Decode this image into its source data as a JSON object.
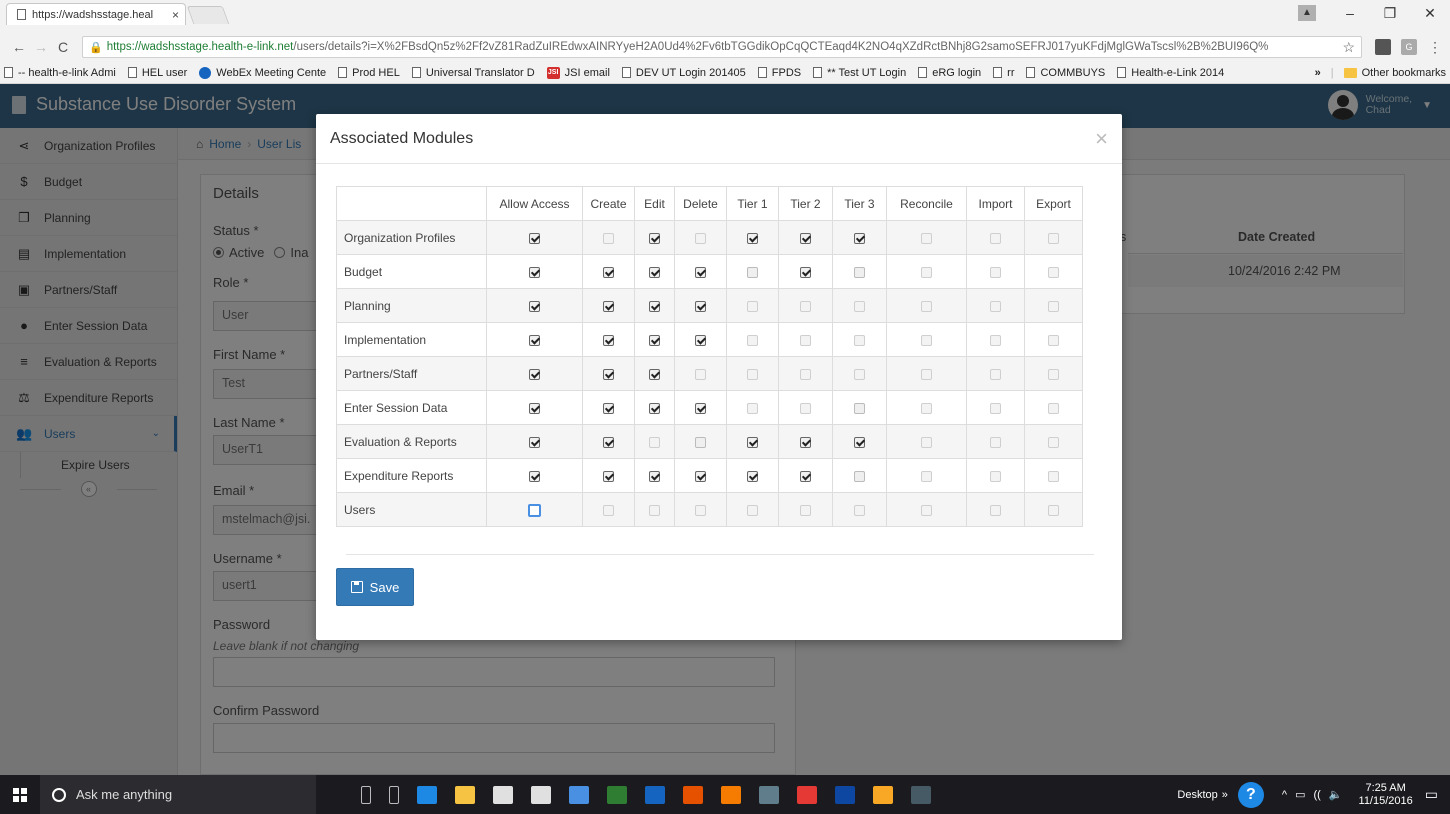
{
  "browser": {
    "tab_title": "https://wadshsstage.heal",
    "tab_close": "×",
    "window_controls": [
      "–",
      "❐",
      "✕"
    ],
    "url_host": "https://wadshsstage.health-e-link.net",
    "url_path": "/users/details?i=X%2FBsdQn5z%2Ff2vZ81RadZuIREdwxAINRYyeH2A0Ud4%2Fv6tbTGGdikOpCqQCTEaqd4K2NO4qXZdRctBNhj8G2samoSEFRJ017yuKFdjMglGWaTscsl%2B%2BUI96Q%",
    "bookmarks": [
      {
        "label": "-- health-e-link Admi",
        "icon": "page-icon"
      },
      {
        "label": "HEL user",
        "icon": "page-icon"
      },
      {
        "label": "WebEx Meeting Cente",
        "icon": "globe-icon"
      },
      {
        "label": "Prod HEL",
        "icon": "page-icon"
      },
      {
        "label": "Universal Translator D",
        "icon": "page-icon"
      },
      {
        "label": "JSI email",
        "icon": "jsi-icon"
      },
      {
        "label": "DEV UT Login 201405",
        "icon": "page-icon"
      },
      {
        "label": "FPDS",
        "icon": "page-icon"
      },
      {
        "label": "** Test UT Login",
        "icon": "page-icon"
      },
      {
        "label": "eRG login",
        "icon": "page-icon"
      },
      {
        "label": "rr",
        "icon": "page-icon"
      },
      {
        "label": "COMMBUYS",
        "icon": "page-icon"
      },
      {
        "label": "Health-e-Link 2014",
        "icon": "page-icon"
      }
    ],
    "bookmarks_more": "»",
    "other_bookmarks": "Other bookmarks"
  },
  "app": {
    "title": "Substance Use Disorder System",
    "welcome_label": "Welcome,",
    "welcome_name": "Chad"
  },
  "sidebar": {
    "items": [
      {
        "label": "Organization Profiles",
        "icon": "share-icon",
        "glyph": "⋖"
      },
      {
        "label": "Budget",
        "icon": "dollar-icon",
        "glyph": "$"
      },
      {
        "label": "Planning",
        "icon": "copy-icon",
        "glyph": "❐"
      },
      {
        "label": "Implementation",
        "icon": "list-box-icon",
        "glyph": "▤"
      },
      {
        "label": "Partners/Staff",
        "icon": "card-icon",
        "glyph": "▣"
      },
      {
        "label": "Enter Session Data",
        "icon": "user-icon",
        "glyph": "●"
      },
      {
        "label": "Evaluation & Reports",
        "icon": "bars-icon",
        "glyph": "≡"
      },
      {
        "label": "Expenditure Reports",
        "icon": "scale-icon",
        "glyph": "⚖"
      },
      {
        "label": "Users",
        "icon": "users-icon",
        "glyph": "👥"
      }
    ],
    "sub_item": "Expire Users",
    "collapse": "«"
  },
  "breadcrumb": {
    "home": "Home",
    "sep": "›",
    "user_list": "User Lis"
  },
  "details": {
    "title": "Details",
    "status_label": "Status *",
    "status_active": "Active",
    "status_inactive": "Ina",
    "role_label": "Role *",
    "role_value": "User",
    "first_name_label": "First Name *",
    "first_name_value": "Test",
    "last_name_label": "Last Name *",
    "last_name_value": "UserT1",
    "email_label": "Email *",
    "email_value": "mstelmach@jsi.",
    "username_label": "Username *",
    "username_value": "usert1",
    "password_label": "Password",
    "password_hint": "Leave blank if not changing",
    "confirm_password_label": "Confirm Password"
  },
  "users_table": {
    "partial_header": "s",
    "date_created_header": "Date Created",
    "date_created_value": "10/24/2016 2:42 PM"
  },
  "modal": {
    "title": "Associated Modules",
    "close": "×",
    "columns": [
      "Allow Access",
      "Create",
      "Edit",
      "Delete",
      "Tier 1",
      "Tier 2",
      "Tier 3",
      "Reconcile",
      "Import",
      "Export"
    ],
    "rows": [
      {
        "name": "Organization Profiles",
        "states": [
          "on",
          "disabled",
          "on",
          "disabled",
          "on",
          "on",
          "on",
          "disabled",
          "disabled",
          "disabled"
        ]
      },
      {
        "name": "Budget",
        "states": [
          "on",
          "on",
          "on",
          "on",
          "off",
          "on",
          "off",
          "disabled",
          "disabled",
          "disabled"
        ]
      },
      {
        "name": "Planning",
        "states": [
          "on",
          "on",
          "on",
          "on",
          "disabled",
          "disabled",
          "disabled",
          "disabled",
          "disabled",
          "disabled"
        ]
      },
      {
        "name": "Implementation",
        "states": [
          "on",
          "on",
          "on",
          "on",
          "disabled",
          "disabled",
          "disabled",
          "disabled",
          "disabled",
          "disabled"
        ]
      },
      {
        "name": "Partners/Staff",
        "states": [
          "on",
          "on",
          "on",
          "disabled",
          "disabled",
          "disabled",
          "disabled",
          "disabled",
          "disabled",
          "disabled"
        ]
      },
      {
        "name": "Enter Session Data",
        "states": [
          "on",
          "on",
          "on",
          "on",
          "disabled",
          "disabled",
          "off",
          "disabled",
          "disabled",
          "disabled"
        ]
      },
      {
        "name": "Evaluation & Reports",
        "states": [
          "on",
          "on",
          "disabled",
          "off",
          "on",
          "on",
          "on",
          "disabled",
          "disabled",
          "disabled"
        ]
      },
      {
        "name": "Expenditure Reports",
        "states": [
          "on",
          "on",
          "on",
          "on",
          "on",
          "on",
          "off",
          "disabled",
          "disabled",
          "disabled"
        ]
      },
      {
        "name": "Users",
        "states": [
          "focus",
          "disabled",
          "disabled",
          "disabled",
          "disabled",
          "disabled",
          "disabled",
          "disabled",
          "disabled",
          "disabled"
        ]
      }
    ],
    "save_label": "Save"
  },
  "taskbar": {
    "search_placeholder": "Ask me anything",
    "desktop_label": "Desktop",
    "more": "»",
    "help": "?",
    "tray_symbols": [
      "^",
      "▭",
      "((",
      "🔈"
    ],
    "time": "7:25 AM",
    "date": "11/15/2016",
    "icons": [
      {
        "name": "mic-icon",
        "color": "#1b1b1f"
      },
      {
        "name": "task-view-icon",
        "color": "#1b1b1f"
      },
      {
        "name": "edge-icon",
        "color": "#1e88e5"
      },
      {
        "name": "file-explorer-icon",
        "color": "#f6c343"
      },
      {
        "name": "store-icon",
        "color": "#e0e0e0"
      },
      {
        "name": "hp-icon",
        "color": "#e0e0e0"
      },
      {
        "name": "app-icon",
        "color": "#4a90e2"
      },
      {
        "name": "excel-icon",
        "color": "#2e7d32"
      },
      {
        "name": "word-icon",
        "color": "#1565c0"
      },
      {
        "name": "powerpoint-icon",
        "color": "#e65100"
      },
      {
        "name": "app2-icon",
        "color": "#f57c00"
      },
      {
        "name": "calculator-icon",
        "color": "#607d8b"
      },
      {
        "name": "chrome-icon",
        "color": "#e53935"
      },
      {
        "name": "solitaire-icon",
        "color": "#0d47a1"
      },
      {
        "name": "norton-icon",
        "color": "#f9a825"
      },
      {
        "name": "app3-icon",
        "color": "#455a64"
      }
    ]
  }
}
